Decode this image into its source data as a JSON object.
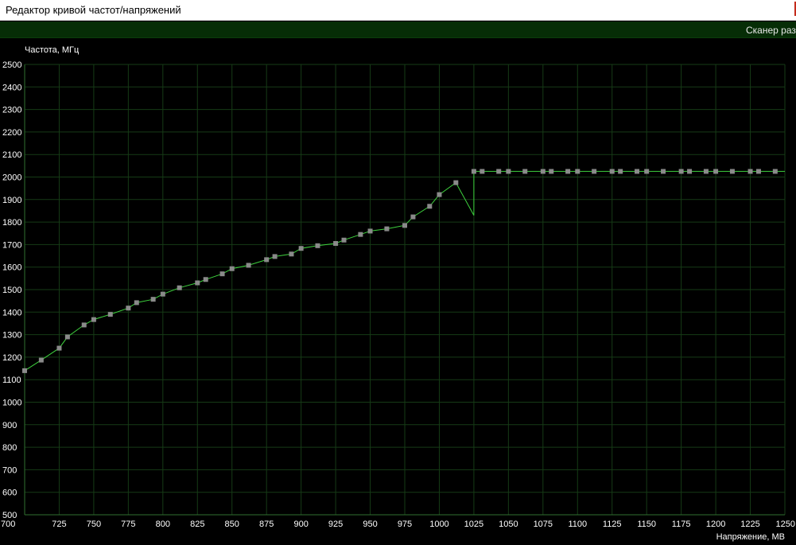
{
  "window": {
    "title": "Редактор кривой частот/напряжений"
  },
  "toolbar": {
    "scanner_label": "Сканер разго"
  },
  "chart_data": {
    "type": "line",
    "title": "",
    "ylabel": "Частота, МГц",
    "xlabel": "Напряжение, МВ",
    "xlim": [
      700,
      1250
    ],
    "ylim": [
      500,
      2500
    ],
    "x_ticks": [
      700,
      725,
      750,
      775,
      800,
      825,
      850,
      875,
      900,
      925,
      950,
      975,
      1000,
      1025,
      1050,
      1075,
      1100,
      1125,
      1150,
      1175,
      1200,
      1225,
      1250
    ],
    "y_ticks": [
      500,
      600,
      700,
      800,
      900,
      1000,
      1100,
      1200,
      1300,
      1400,
      1500,
      1600,
      1700,
      1800,
      1900,
      2000,
      2100,
      2200,
      2300,
      2400,
      2500
    ],
    "grid": true,
    "colors": {
      "line": "#3ed13e",
      "point": "#8a8a8a",
      "grid": "#163b16",
      "axis": "#2f6f2f"
    },
    "series": [
      {
        "points": [
          [
            700,
            1140
          ],
          [
            712,
            1187
          ],
          [
            725,
            1240
          ],
          [
            731,
            1290
          ],
          [
            743,
            1343
          ],
          [
            750,
            1367
          ],
          [
            762,
            1390
          ],
          [
            775,
            1418
          ],
          [
            781,
            1442
          ],
          [
            793,
            1457
          ],
          [
            800,
            1480
          ],
          [
            812,
            1508
          ],
          [
            825,
            1530
          ],
          [
            831,
            1545
          ],
          [
            843,
            1570
          ],
          [
            850,
            1593
          ],
          [
            862,
            1608
          ],
          [
            875,
            1633
          ],
          [
            881,
            1647
          ],
          [
            893,
            1658
          ],
          [
            900,
            1683
          ],
          [
            912,
            1695
          ],
          [
            925,
            1705
          ],
          [
            931,
            1720
          ],
          [
            943,
            1745
          ],
          [
            950,
            1760
          ],
          [
            962,
            1770
          ],
          [
            975,
            1785
          ],
          [
            981,
            1823
          ],
          [
            993,
            1870
          ],
          [
            1000,
            1922
          ],
          [
            1012,
            1975
          ],
          [
            1025,
            2025
          ],
          [
            1031,
            2025
          ],
          [
            1043,
            2025
          ],
          [
            1050,
            2025
          ],
          [
            1062,
            2025
          ],
          [
            1075,
            2025
          ],
          [
            1081,
            2025
          ],
          [
            1093,
            2025
          ],
          [
            1100,
            2025
          ],
          [
            1112,
            2025
          ],
          [
            1125,
            2025
          ],
          [
            1131,
            2025
          ],
          [
            1143,
            2025
          ],
          [
            1150,
            2025
          ],
          [
            1162,
            2025
          ],
          [
            1175,
            2025
          ],
          [
            1181,
            2025
          ],
          [
            1193,
            2025
          ],
          [
            1200,
            2025
          ],
          [
            1212,
            2025
          ],
          [
            1225,
            2025
          ],
          [
            1231,
            2025
          ],
          [
            1243,
            2025
          ]
        ],
        "dip_point": [
          1025,
          1830
        ],
        "tail_end": [
          1250,
          2025
        ]
      }
    ]
  }
}
